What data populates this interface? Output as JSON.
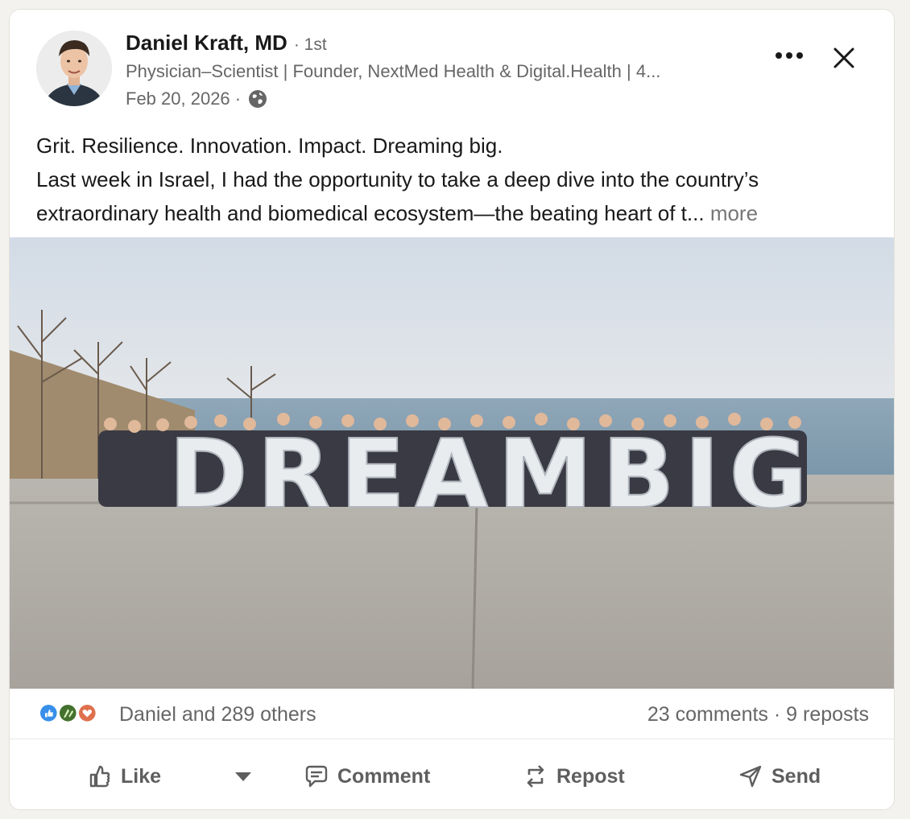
{
  "author": {
    "name": "Daniel Kraft, MD",
    "degree": "· 1st",
    "headline": "Physician–Scientist | Founder, NextMed Health & Digital.Health | 4...",
    "date": "Feb 20, 2026 ·"
  },
  "post": {
    "line1": "Grit. Resilience. Innovation. Impact. Dreaming big.",
    "line2": "Last week in Israel, I had the opportunity to take a deep dive into the country’s",
    "line3": "extraordinary health and biomedical ecosystem—the beating heart of t...",
    "see_more": "more"
  },
  "photo": {
    "sign_text": "DREAMBIG"
  },
  "social": {
    "reactions_label": "Daniel and 289 others",
    "comments": "23 comments",
    "separator": "·",
    "reposts": "9 reposts"
  },
  "actions": {
    "like": "Like",
    "comment": "Comment",
    "repost": "Repost",
    "send": "Send"
  },
  "colors": {
    "like_blue": "#378fe9",
    "celebrate_green": "#44712e",
    "love_red": "#df704d",
    "muted_text": "#666666"
  }
}
